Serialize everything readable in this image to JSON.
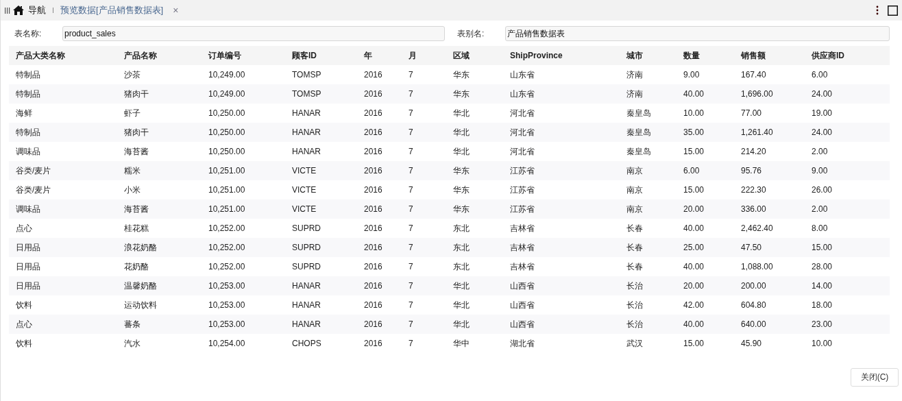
{
  "tabs": [
    {
      "label": "导航",
      "kind": "home",
      "selected": false
    },
    {
      "label": "预览数据[产品销售数据表]",
      "kind": "closable",
      "close": "×",
      "selected": true
    }
  ],
  "form": {
    "table_name_label": "表名称:",
    "table_name": "product_sales",
    "alias_label": "表别名:",
    "alias": "产品销售数据表"
  },
  "table": {
    "columns": [
      "产品大类名称",
      "产品名称",
      "订单编号",
      "顾客ID",
      "年",
      "月",
      "区域",
      "ShipProvince",
      "城市",
      "数量",
      "销售额",
      "供应商ID"
    ],
    "rows": [
      [
        "特制品",
        "沙茶",
        "10,249.00",
        "TOMSP",
        "2016",
        "7",
        "华东",
        "山东省",
        "济南",
        "9.00",
        "167.40",
        "6.00"
      ],
      [
        "特制品",
        "猪肉干",
        "10,249.00",
        "TOMSP",
        "2016",
        "7",
        "华东",
        "山东省",
        "济南",
        "40.00",
        "1,696.00",
        "24.00"
      ],
      [
        "海鲜",
        "虾子",
        "10,250.00",
        "HANAR",
        "2016",
        "7",
        "华北",
        "河北省",
        "秦皇岛",
        "10.00",
        "77.00",
        "19.00"
      ],
      [
        "特制品",
        "猪肉干",
        "10,250.00",
        "HANAR",
        "2016",
        "7",
        "华北",
        "河北省",
        "秦皇岛",
        "35.00",
        "1,261.40",
        "24.00"
      ],
      [
        "调味品",
        "海苔酱",
        "10,250.00",
        "HANAR",
        "2016",
        "7",
        "华北",
        "河北省",
        "秦皇岛",
        "15.00",
        "214.20",
        "2.00"
      ],
      [
        "谷类/麦片",
        "糯米",
        "10,251.00",
        "VICTE",
        "2016",
        "7",
        "华东",
        "江苏省",
        "南京",
        "6.00",
        "95.76",
        "9.00"
      ],
      [
        "谷类/麦片",
        "小米",
        "10,251.00",
        "VICTE",
        "2016",
        "7",
        "华东",
        "江苏省",
        "南京",
        "15.00",
        "222.30",
        "26.00"
      ],
      [
        "调味品",
        "海苔酱",
        "10,251.00",
        "VICTE",
        "2016",
        "7",
        "华东",
        "江苏省",
        "南京",
        "20.00",
        "336.00",
        "2.00"
      ],
      [
        "点心",
        "桂花糕",
        "10,252.00",
        "SUPRD",
        "2016",
        "7",
        "东北",
        "吉林省",
        "长春",
        "40.00",
        "2,462.40",
        "8.00"
      ],
      [
        "日用品",
        "浪花奶酪",
        "10,252.00",
        "SUPRD",
        "2016",
        "7",
        "东北",
        "吉林省",
        "长春",
        "25.00",
        "47.50",
        "15.00"
      ],
      [
        "日用品",
        "花奶酪",
        "10,252.00",
        "SUPRD",
        "2016",
        "7",
        "东北",
        "吉林省",
        "长春",
        "40.00",
        "1,088.00",
        "28.00"
      ],
      [
        "日用品",
        "温馨奶酪",
        "10,253.00",
        "HANAR",
        "2016",
        "7",
        "华北",
        "山西省",
        "长治",
        "20.00",
        "200.00",
        "14.00"
      ],
      [
        "饮料",
        "运动饮料",
        "10,253.00",
        "HANAR",
        "2016",
        "7",
        "华北",
        "山西省",
        "长治",
        "42.00",
        "604.80",
        "18.00"
      ],
      [
        "点心",
        "蕃条",
        "10,253.00",
        "HANAR",
        "2016",
        "7",
        "华北",
        "山西省",
        "长治",
        "40.00",
        "640.00",
        "23.00"
      ],
      [
        "饮料",
        "汽水",
        "10,254.00",
        "CHOPS",
        "2016",
        "7",
        "华中",
        "湖北省",
        "武汉",
        "15.00",
        "45.90",
        "10.00"
      ]
    ]
  },
  "buttons": [
    "关闭(C)"
  ]
}
